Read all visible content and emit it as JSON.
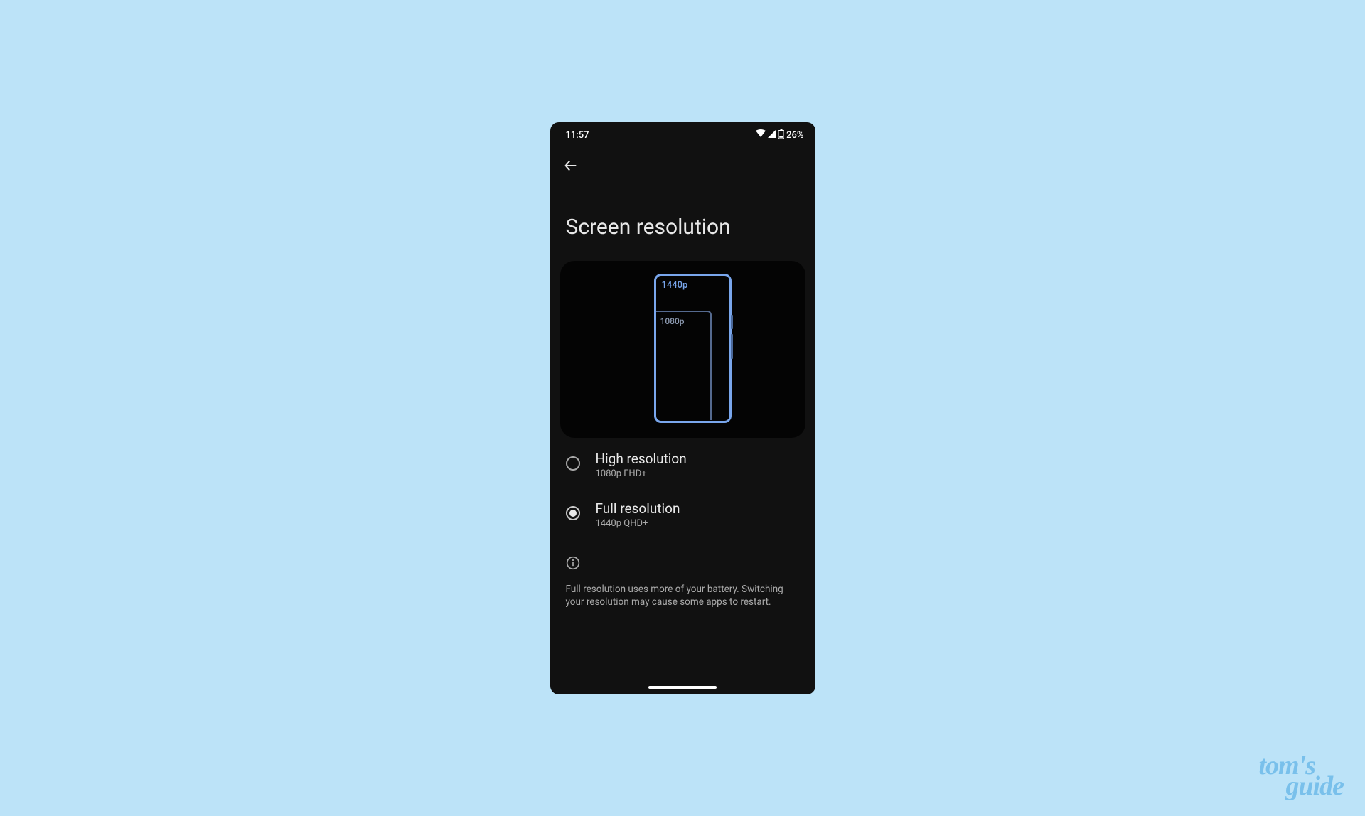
{
  "statusbar": {
    "time": "11:57",
    "battery_pct": "26%"
  },
  "page": {
    "title": "Screen resolution"
  },
  "preview": {
    "label_1440": "1440p",
    "label_1080": "1080p"
  },
  "options": [
    {
      "title": "High resolution",
      "subtitle": "1080p FHD+",
      "selected": false
    },
    {
      "title": "Full resolution",
      "subtitle": "1440p QHD+",
      "selected": true
    }
  ],
  "info": {
    "text": "Full resolution uses more of your battery. Switching your resolution may cause some apps to restart."
  },
  "watermark": {
    "line1": "tom's",
    "line2": "guide"
  }
}
